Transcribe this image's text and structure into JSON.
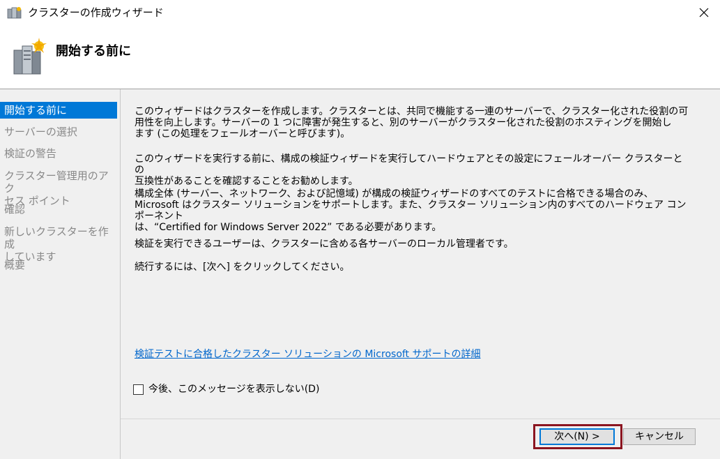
{
  "window": {
    "title": "クラスターの作成ウィザード",
    "close_icon": "close-icon"
  },
  "header": {
    "title": "開始する前に",
    "icon": "cluster-servers-icon"
  },
  "sidebar": {
    "items": [
      {
        "label": "開始する前に",
        "active": true
      },
      {
        "label": "サーバーの選択",
        "active": false
      },
      {
        "label": "検証の警告",
        "active": false
      },
      {
        "label_line1": "クラスター管理用のアク",
        "label_line2": "セス ポイント",
        "active": false
      },
      {
        "label": "確認",
        "active": false
      },
      {
        "label_line1": "新しいクラスターを作成",
        "label_line2": "しています",
        "active": false
      },
      {
        "label": "概要",
        "active": false
      }
    ]
  },
  "content": {
    "para1": [
      "このウィザードはクラスターを作成します。クラスターとは、共同で機能する一連のサーバーで、クラスター化された役割の可",
      "用性を向上します。サーバーの 1 つに障害が発生すると、別のサーバーがクラスター化された役割のホスティングを開始し",
      "ます (この処理をフェールオーバーと呼びます)。"
    ],
    "para2": [
      "このウィザードを実行する前に、構成の検証ウィザードを実行してハードウェアとその設定にフェールオーバー クラスターとの",
      "互換性があることを確認することをお勧めします。"
    ],
    "para3": [
      "構成全体 (サーバー、ネットワーク、および記憶域) が構成の検証ウィザードのすべてのテストに合格できる場合のみ、",
      "Microsoft はクラスター ソリューションをサポートします。また、クラスター ソリューション内のすべてのハードウェア コンポーネント",
      "は、“Certified for Windows Server 2022” である必要があります。"
    ],
    "para4": "検証を実行できるユーザーは、クラスターに含める各サーバーのローカル管理者です。",
    "para5": "続行するには、[次へ] をクリックしてください。",
    "link": "検証テストに合格したクラスター ソリューションの Microsoft サポートの詳細",
    "checkbox_label": "今後、このメッセージを表示しない(D)",
    "checkbox_checked": false
  },
  "buttons": {
    "next": "次へ(N) >",
    "cancel": "キャンセル"
  },
  "colors": {
    "selection": "#0078d7",
    "link": "#0066cc",
    "highlight_border": "#8b1520"
  }
}
